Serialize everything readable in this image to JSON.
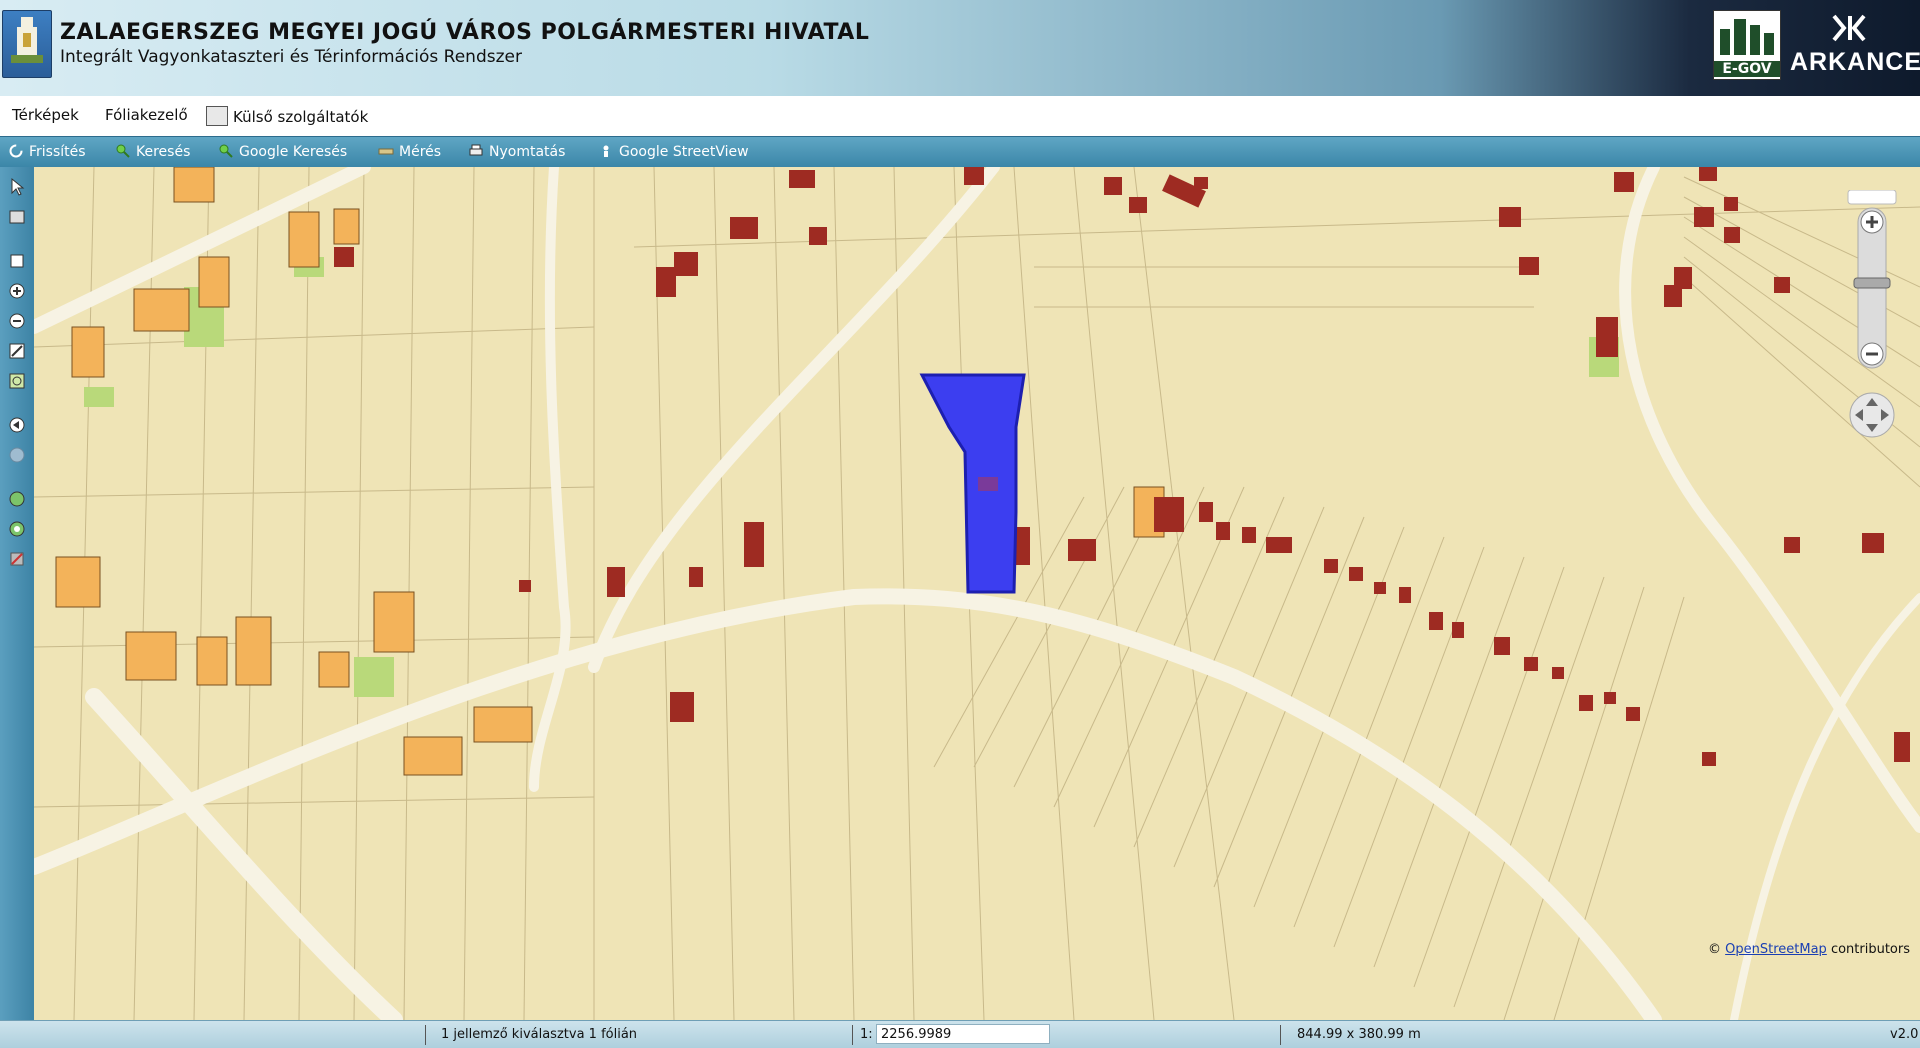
{
  "header": {
    "title": "ZALAEGERSZEG MEGYEI JOGÚ VÁROS POLGÁRMESTERI HIVATAL",
    "subtitle": "Integrált Vagyonkataszteri és Térinformációs Rendszer",
    "citylogo_label": "E-GOV",
    "vendor_logo": "ARKANCE"
  },
  "menu": {
    "maps": "Térképek",
    "layers": "Fóliakezelő",
    "external": "Külső szolgáltatók"
  },
  "toolbar": {
    "refresh": "Frissítés",
    "search": "Keresés",
    "google_search": "Google Keresés",
    "measure": "Mérés",
    "print": "Nyomtatás",
    "streetview": "Google StreetView"
  },
  "map": {
    "attribution_prefix": "© ",
    "attribution_link": "OpenStreetMap",
    "attribution_suffix": " contributors",
    "colors": {
      "background": "#efe4b6",
      "selected_parcel": "#3c3ef0",
      "building_red": "#9e2b22",
      "building_orange": "#f3b35a",
      "road": "#f7f3e4"
    }
  },
  "status": {
    "selection": "1 jellemző kiválasztva 1 fólián",
    "scale_prefix": "1:",
    "scale_value": "2256.9989",
    "extent": "844.99 x 380.99 m",
    "version": "v2.0"
  }
}
